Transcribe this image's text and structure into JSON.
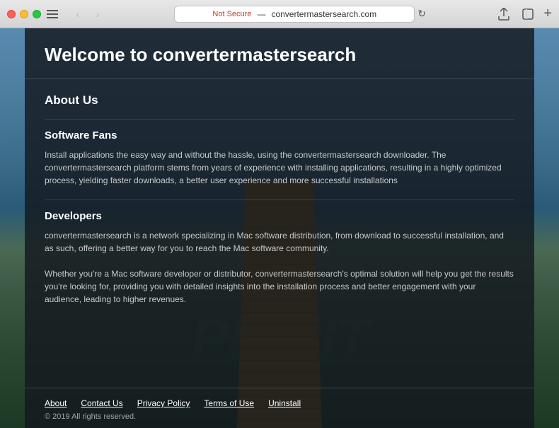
{
  "browser": {
    "security_label": "Not Secure",
    "url": "convertermastersearch.com",
    "tab_label": "convertermastersearch.com"
  },
  "page": {
    "site_title": "Welcome to convertermastersearch",
    "about_section": {
      "heading": "About Us",
      "software_fans": {
        "heading": "Software Fans",
        "text": "Install applications the easy way and without the hassle, using the convertermastersearch downloader. The convertermastersearch platform stems from years of experience with installing applications, resulting in a highly optimized process, yielding faster downloads, a better user experience and more successful installations"
      },
      "developers": {
        "heading": "Developers",
        "text1": "convertermastersearch is a network specializing in Mac software distribution, from download to successful installation, and as such, offering a better way for you to reach the Mac software community.",
        "text2": "Whether you're a Mac software developer or distributor, convertermastersearch's optimal solution will help you get the results you're looking for, providing you with detailed insights into the installation process and better engagement with your audience, leading to higher revenues."
      }
    },
    "footer": {
      "links": [
        "About",
        "Contact Us",
        "Privacy Policy",
        "Terms of Use",
        "Uninstall"
      ],
      "copyright": "© 2019 All rights reserved."
    }
  }
}
